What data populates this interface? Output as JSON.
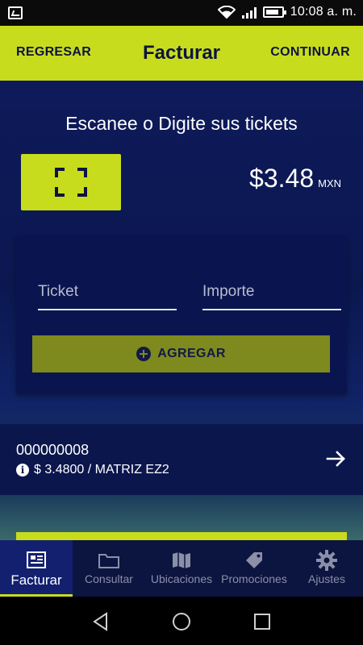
{
  "status_bar": {
    "time": "10:08 a. m.",
    "icons": [
      "gallery-icon",
      "wifi-icon",
      "signal-icon",
      "battery-icon"
    ]
  },
  "app_bar": {
    "back_label": "REGRESAR",
    "title": "Facturar",
    "continue_label": "CONTINUAR"
  },
  "main": {
    "heading": "Escanee o Digite sus tickets",
    "scan_icon": "scan-frame-icon",
    "total": {
      "amount": "$3.48",
      "currency": "MXN"
    },
    "form": {
      "ticket_placeholder": "Ticket",
      "importe_placeholder": "Importe",
      "add_label": "AGREGAR"
    },
    "tickets": [
      {
        "number": "000000008",
        "detail": "$ 3.4800 / MATRIZ EZ2"
      }
    ]
  },
  "tabs": [
    {
      "label": "Facturar",
      "icon": "invoice-icon",
      "active": true
    },
    {
      "label": "Consultar",
      "icon": "folder-icon",
      "active": false
    },
    {
      "label": "Ubicaciones",
      "icon": "map-icon",
      "active": false
    },
    {
      "label": "Promociones",
      "icon": "tag-icon",
      "active": false
    },
    {
      "label": "Ajustes",
      "icon": "gear-icon",
      "active": false
    }
  ],
  "colors": {
    "accent": "#c8dc1e",
    "background": "#0a0f3c",
    "button_dim": "#7e8a1e"
  }
}
